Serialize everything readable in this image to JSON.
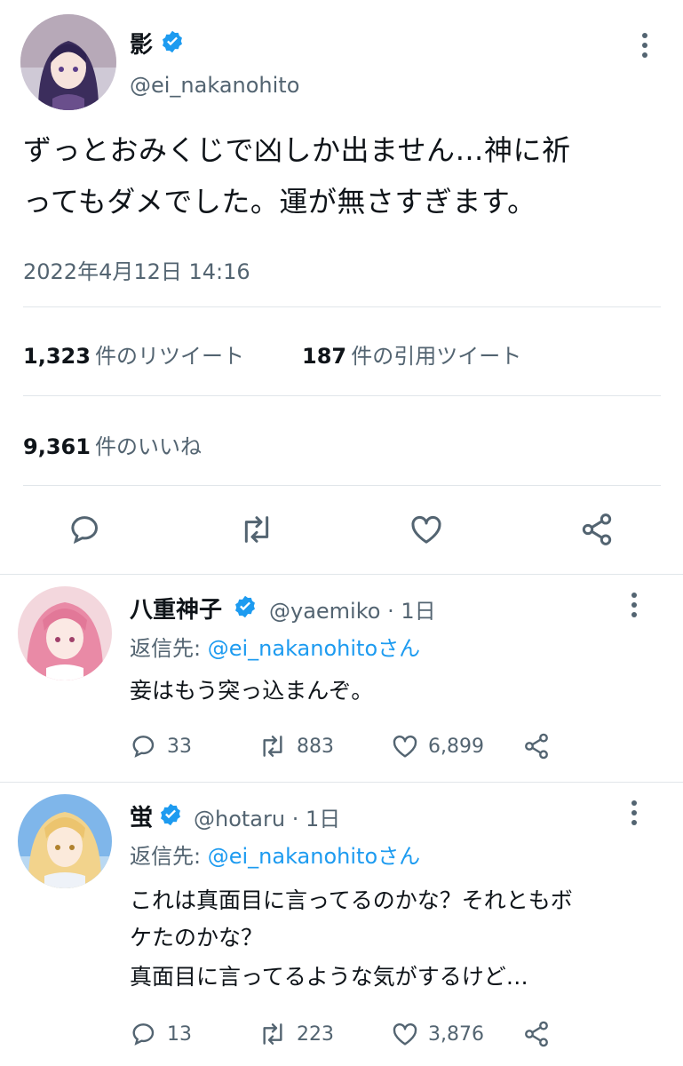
{
  "main_tweet": {
    "author_name": "影",
    "handle": "@ei_nakanohito",
    "text_line1": "ずっとおみくじで凶しか出ません…神に祈",
    "text_line2": "ってもダメでした。運が無さすぎます。",
    "timestamp": "2022年4月12日 14:16",
    "retweets_count": "1,323",
    "retweets_label": "件のリツイート",
    "quotes_count": "187",
    "quotes_label": "件の引用ツイート",
    "likes_count": "9,361",
    "likes_label": "件のいいね",
    "avatar_icon": "avatar-purple-hair",
    "verified_icon": "verified-badge-icon"
  },
  "replies": [
    {
      "author_name": "八重神子",
      "handle": "@yaemiko",
      "time": "· 1日",
      "reply_to_prefix": "返信先: ",
      "reply_to_handle": "@ei_nakanohitoさん",
      "text": "妾はもう突っ込まんぞ。",
      "reply_count": "33",
      "retweet_count": "883",
      "like_count": "6,899",
      "avatar_icon": "avatar-pink-hair"
    },
    {
      "author_name": "蛍",
      "handle": "@hotaru",
      "time": "· 1日",
      "reply_to_prefix": "返信先: ",
      "reply_to_handle": "@ei_nakanohitoさん",
      "text_line1": "これは真面目に言ってるのかな？それともボ",
      "text_line2": "ケたのかな？",
      "text_line3": "真面目に言ってるような気がするけど…",
      "reply_count": "13",
      "retweet_count": "223",
      "like_count": "3,876",
      "avatar_icon": "avatar-blonde-hair"
    }
  ],
  "colors": {
    "accent": "#1d9bf0",
    "secondary_text": "#536471",
    "divider": "#e1e6ea"
  }
}
